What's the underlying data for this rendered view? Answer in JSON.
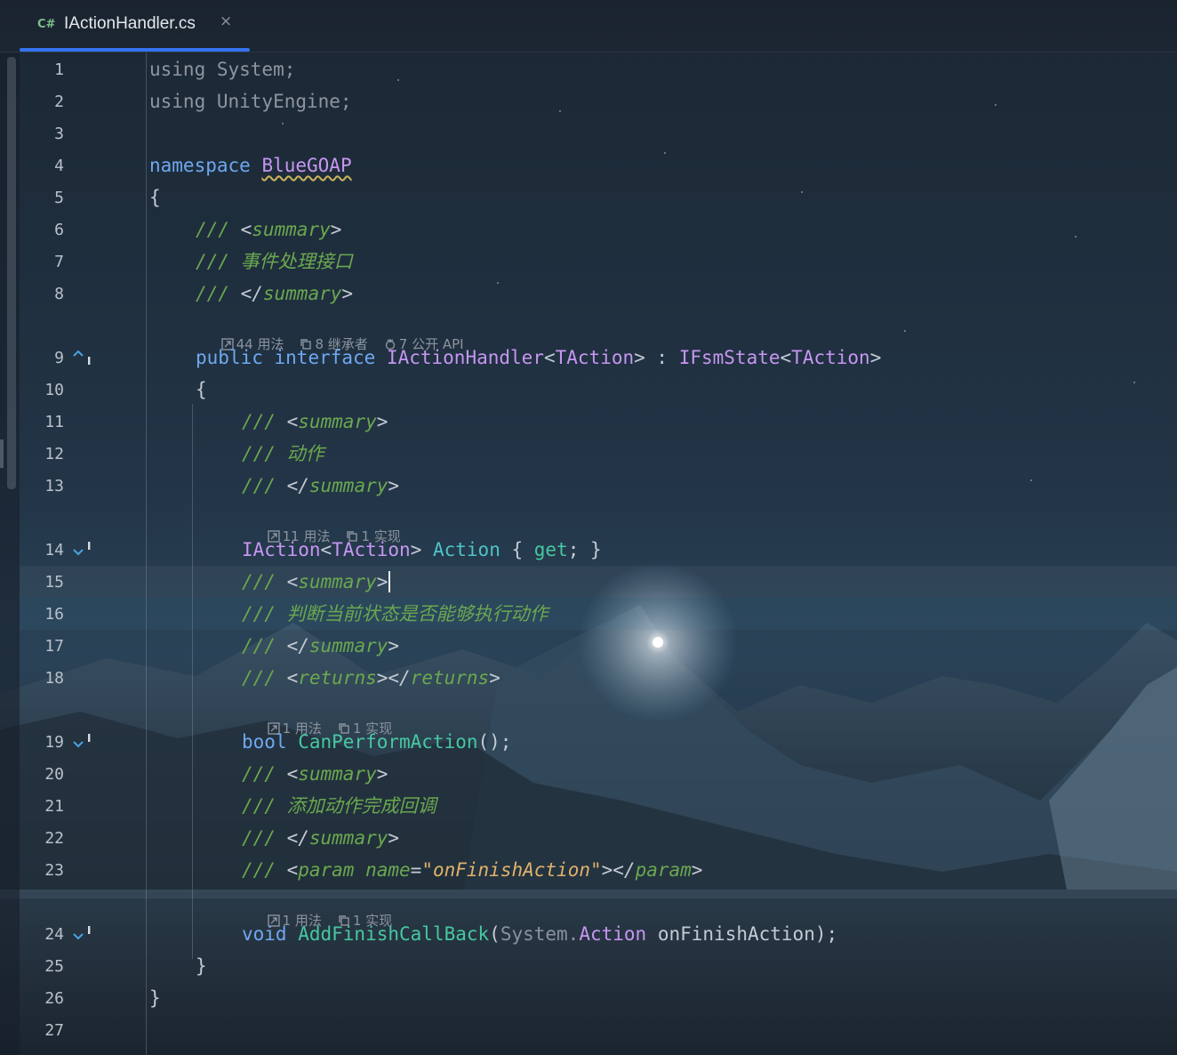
{
  "tab": {
    "lang": "C#",
    "title": "IActionHandler.cs",
    "close": "×"
  },
  "lines": [
    {
      "n": "1",
      "tokens": {
        "a": "using ",
        "b": "System;"
      }
    },
    {
      "n": "2",
      "tokens": {
        "a": "using ",
        "b": "UnityEngine;"
      }
    },
    {
      "n": "3"
    },
    {
      "n": "4",
      "tokens": {
        "kw": "namespace ",
        "ns": "BlueGOAP"
      }
    },
    {
      "n": "5",
      "tokens": {
        "brace": "{"
      }
    },
    {
      "n": "6",
      "tokens": {
        "c": "/// ",
        "lt": "<",
        "tag": "summary",
        "gt": ">"
      }
    },
    {
      "n": "7",
      "tokens": {
        "c": "/// 事件处理接口"
      }
    },
    {
      "n": "8",
      "tokens": {
        "c": "/// ",
        "lt": "</",
        "tag": "summary",
        "gt": ">"
      }
    },
    {
      "n": "9",
      "tokens": {
        "kw1": "public ",
        "kw2": "interface ",
        "name": "IActionHandler",
        "lt": "<",
        "tp": "TAction",
        "gt": "> : ",
        "base": "IFsmState",
        "lt2": "<",
        "tp2": "TAction",
        "gt2": ">"
      }
    },
    {
      "n": "10",
      "tokens": {
        "brace": "{"
      }
    },
    {
      "n": "11",
      "tokens": {
        "c": "/// ",
        "lt": "<",
        "tag": "summary",
        "gt": ">"
      }
    },
    {
      "n": "12",
      "tokens": {
        "c": "/// 动作"
      }
    },
    {
      "n": "13",
      "tokens": {
        "c": "/// ",
        "lt": "</",
        "tag": "summary",
        "gt": ">"
      }
    },
    {
      "n": "14",
      "tokens": {
        "type": "IAction",
        "lt": "<",
        "tp": "TAction",
        "gt": "> ",
        "prop": "Action",
        "ob": " { ",
        "get": "get",
        "cb": "; }"
      }
    },
    {
      "n": "15",
      "tokens": {
        "c": "/// ",
        "lt": "<",
        "tag": "summary",
        "gt": ">"
      }
    },
    {
      "n": "16",
      "tokens": {
        "c": "/// 判断当前状态是否能够执行动作"
      }
    },
    {
      "n": "17",
      "tokens": {
        "c": "/// ",
        "lt": "</",
        "tag": "summary",
        "gt": ">"
      }
    },
    {
      "n": "18",
      "tokens": {
        "c": "/// ",
        "lt": "<",
        "tag": "returns",
        "mid": "></",
        "tag2": "returns",
        "gt": ">"
      }
    },
    {
      "n": "19",
      "tokens": {
        "kw": "bool ",
        "meth": "CanPerformAction",
        "rest": "();"
      }
    },
    {
      "n": "20",
      "tokens": {
        "c": "/// ",
        "lt": "<",
        "tag": "summary",
        "gt": ">"
      }
    },
    {
      "n": "21",
      "tokens": {
        "c": "/// 添加动作完成回调"
      }
    },
    {
      "n": "22",
      "tokens": {
        "c": "/// ",
        "lt": "</",
        "tag": "summary",
        "gt": ">"
      }
    },
    {
      "n": "23",
      "tokens": {
        "c": "/// ",
        "lt": "<",
        "tag": "param ",
        "attr": "name",
        "eq": "=",
        "str": "\"onFinishAction\"",
        "mid": "></",
        "tag2": "param",
        "gt": ">"
      }
    },
    {
      "n": "24",
      "tokens": {
        "kw": "void ",
        "meth": "AddFinishCallBack",
        "po": "(",
        "sys": "System.",
        "act": "Action",
        "param": " onFinishAction",
        "pc": ");"
      }
    },
    {
      "n": "25",
      "tokens": {
        "brace": "}"
      }
    },
    {
      "n": "26",
      "tokens": {
        "brace": "}"
      }
    },
    {
      "n": "27"
    }
  ],
  "hints": {
    "h9": {
      "usages": "44 用法",
      "inheritors": "8 继承者",
      "api": "7 公开 API"
    },
    "h14": {
      "usages": "11 用法",
      "impl": "1 实现"
    },
    "h19": {
      "usages": "1 用法",
      "impl": "1 实现"
    },
    "h24": {
      "usages": "1 用法",
      "impl": "1 实现"
    }
  },
  "colors": {
    "accent": "#3574f0",
    "keyword": "#6fa8f0",
    "type": "#c696f0",
    "comment": "#6aa84f",
    "method": "#46c8a0"
  }
}
